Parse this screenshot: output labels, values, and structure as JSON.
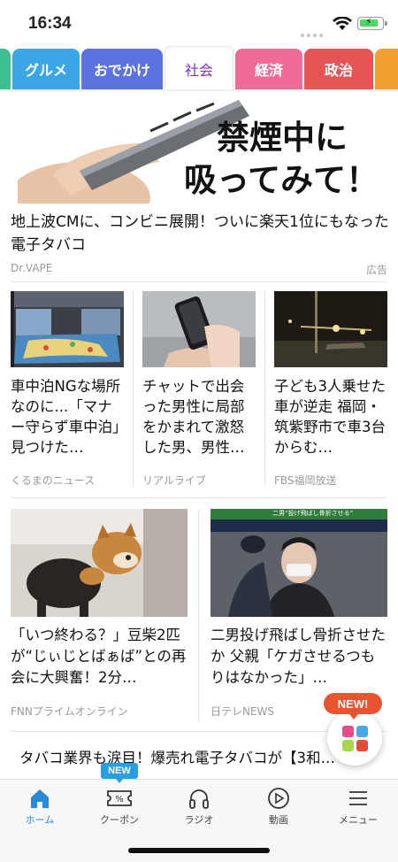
{
  "status_bar": {
    "time": "16:34"
  },
  "tabs": [
    {
      "label": "グルメ",
      "color": "#3ba6e6"
    },
    {
      "label": "おでかけ",
      "color": "#5a73e0"
    },
    {
      "label": "社会",
      "color": "#ffffff",
      "active": true
    },
    {
      "label": "経済",
      "color": "#ee6b9a"
    },
    {
      "label": "政治",
      "color": "#e55555"
    }
  ],
  "ad": {
    "image_text_1": "禁煙中に",
    "image_text_2": "吸ってみて！",
    "headline": "地上波CMに、コンビニ展開！ついに楽天1位にもなった電子タバコ",
    "source": "Dr.VAPE",
    "label": "広告"
  },
  "articles_row1": [
    {
      "title": "車中泊NGな場所なのに...「マナー守らず車中泊」見つけた…",
      "source": "くるまのニュース"
    },
    {
      "title": "チャットで出会った男性に局部をかまれて激怒した男、男性…",
      "source": "リアルライブ"
    },
    {
      "title": "子ども3人乗せた車が逆走 福岡・筑紫野市で車3台からむ…",
      "source": "FBS福岡放送"
    }
  ],
  "articles_row2": [
    {
      "title": "「いつ終わる？」豆柴2匹が“じぃじとばぁば”との再会に大興奮！2分…",
      "source": "FNNプライムオンライン"
    },
    {
      "title": "二男投げ飛ばし骨折させたか 父親「ケガさせるつもりはなかった」…",
      "source": "日テレNEWS",
      "image_caption": "二男“投げ飛ばし骨折させる”"
    }
  ],
  "bottom_headline": "タバコ業界も涙目！爆売れ電子タバコが【3和…",
  "fab": {
    "badge": "NEW!"
  },
  "nav": {
    "new_badge": "NEW",
    "items": [
      {
        "label": "ホーム",
        "icon": "home-icon",
        "active": true
      },
      {
        "label": "クーポン",
        "icon": "coupon-icon"
      },
      {
        "label": "ラジオ",
        "icon": "headphones-icon"
      },
      {
        "label": "動画",
        "icon": "play-icon"
      },
      {
        "label": "メニュー",
        "icon": "menu-icon"
      }
    ]
  },
  "colors": {
    "accent_purple": "#7b2fd0",
    "nav_active": "#2a8ad8",
    "fab_badge": "#e8542f"
  }
}
